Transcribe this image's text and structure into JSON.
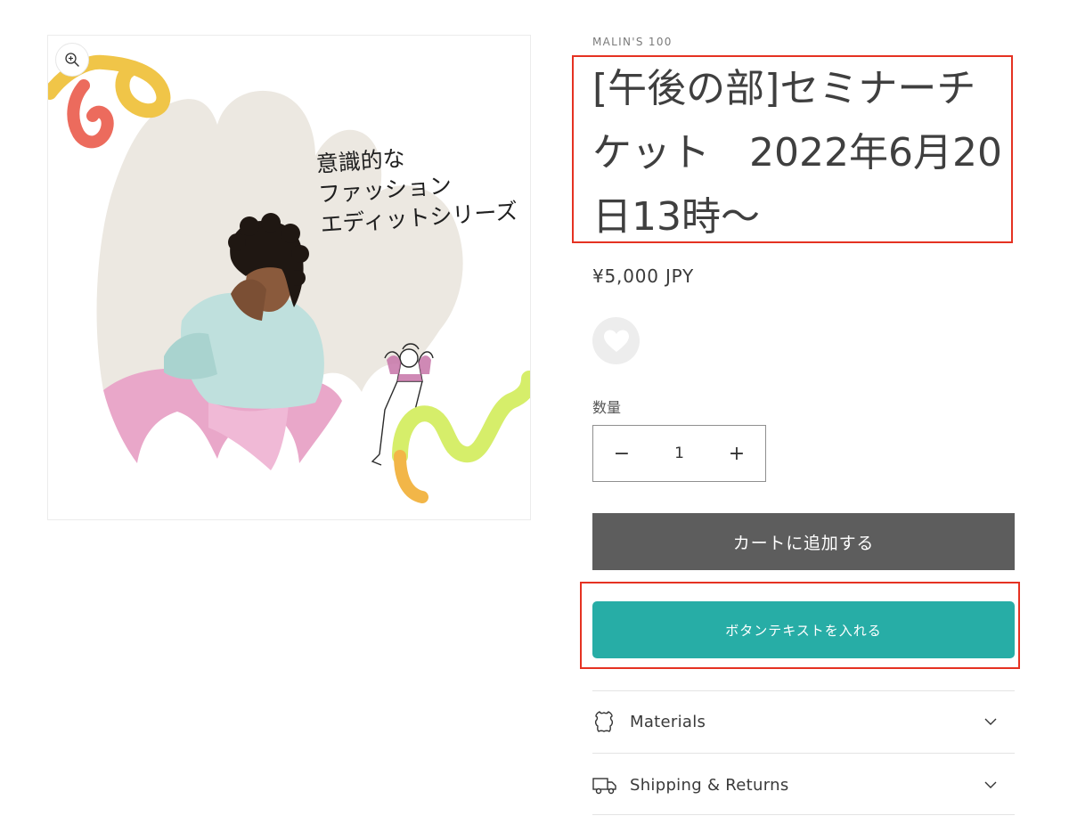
{
  "media": {
    "headline_lines": [
      "意識的な",
      "ファッション",
      "エディットシリーズ"
    ],
    "zoom_icon": "zoom-in-icon"
  },
  "product": {
    "vendor": "MALIN'S 100",
    "title": "[午後の部]セミナーチケット　2022年6月20日13時〜",
    "price": "¥5,000 JPY",
    "wishlist_icon": "heart-icon"
  },
  "quantity": {
    "label": "数量",
    "value": "1",
    "decrease_label": "−",
    "increase_label": "+"
  },
  "actions": {
    "add_to_cart_label": "カートに追加する",
    "custom_button_label": "ボタンテキストを入れる",
    "custom_button_color": "#27ada6",
    "add_to_cart_color": "#5d5d5d"
  },
  "accordion": [
    {
      "label": "Materials",
      "icon": "leather-icon"
    },
    {
      "label": "Shipping & Returns",
      "icon": "truck-icon"
    }
  ],
  "annotation_color": "#e53222"
}
